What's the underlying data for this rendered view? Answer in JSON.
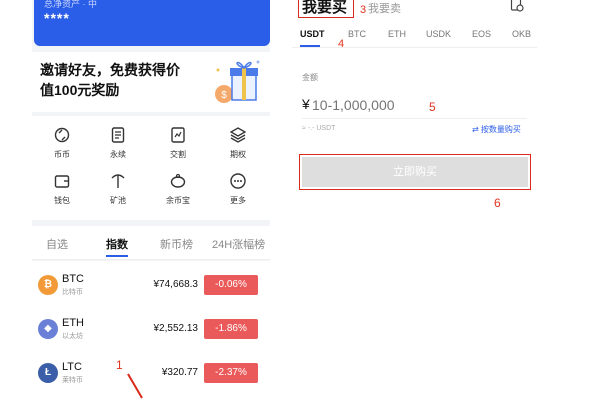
{
  "left_panel": {
    "asset_label": "总净资产 · 中",
    "asset_value": "****",
    "promo_text": "邀请好友，免费获得价值100元奖励",
    "grid": [
      {
        "label": "币币",
        "icon": "coin-swap-icon"
      },
      {
        "label": "永续",
        "icon": "document-icon"
      },
      {
        "label": "交割",
        "icon": "contract-icon"
      },
      {
        "label": "期权",
        "icon": "layers-icon"
      },
      {
        "label": "钱包",
        "icon": "wallet-icon"
      },
      {
        "label": "矿池",
        "icon": "pickaxe-icon"
      },
      {
        "label": "余币宝",
        "icon": "piggy-bank-icon"
      },
      {
        "label": "更多",
        "icon": "more-icon"
      }
    ],
    "tabs": [
      "自选",
      "指数",
      "新币榜",
      "24H涨幅榜"
    ],
    "active_tab": "指数",
    "coins": [
      {
        "symbol": "BTC",
        "name": "比特币",
        "price": "¥74,668.3",
        "change": "-0.06%",
        "color": "#f29a38"
      },
      {
        "symbol": "ETH",
        "name": "以太坊",
        "price": "¥2,552.13",
        "change": "-1.86%",
        "color": "#6a7fd6"
      },
      {
        "symbol": "LTC",
        "name": "莱特币",
        "price": "¥320.77",
        "change": "-2.37%",
        "color": "#3a5ea8"
      }
    ],
    "annotation": "1"
  },
  "right_panel": {
    "buy_tab": "我要买",
    "sell_tab": "我要卖",
    "annotation_3": "3",
    "currencies": [
      "USDT",
      "BTC",
      "ETH",
      "USDK",
      "EOS",
      "OKB"
    ],
    "active_currency": "USDT",
    "annotation_4": "4",
    "amount_label": "金额",
    "currency_symbol": "¥",
    "amount_placeholder": "10-1,000,000",
    "annotation_5": "5",
    "approx_text": "≈ -.- USDT",
    "toggle_mode": "⇄ 按数量购买",
    "buy_button": "立即购买",
    "annotation_6": "6"
  },
  "colors": {
    "accent": "#2b5ee8",
    "down": "#ea5a5a",
    "annotation": "#d92a1c"
  }
}
